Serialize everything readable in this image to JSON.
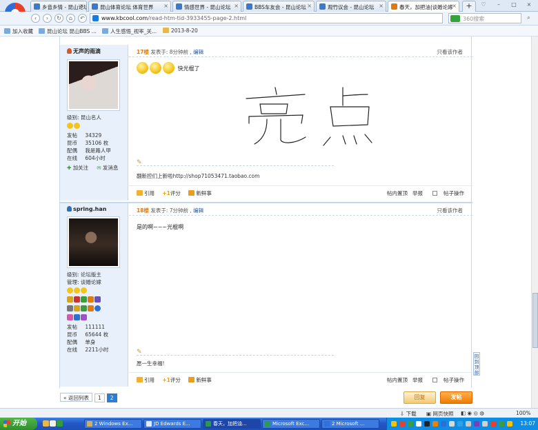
{
  "browser": {
    "tabs": [
      {
        "title": "乡音乡情 - 昆山论坛"
      },
      {
        "title": "昆山体育论坛 体育世界"
      },
      {
        "title": "情感世界 - 昆山论坛"
      },
      {
        "title": "BBS车友会 - 昆山论坛"
      },
      {
        "title": "观竹议会 - 昆山论坛"
      },
      {
        "title": "春天，加把油|谈婚论嫁"
      }
    ],
    "new_tab": "+",
    "url_domain": "www.kbcool.com",
    "url_path": "/read-htm-tid-3933455-page-2.html",
    "search_placeholder": "360搜索",
    "bookmarks": [
      {
        "label": "加入收藏"
      },
      {
        "label": "昆山论坛 昆山BBS ..."
      },
      {
        "label": "人生感悟_视率_关..."
      },
      {
        "label": "2013-8-20"
      }
    ]
  },
  "posts": [
    {
      "username": "无声的雨滴",
      "level_label": "级别:",
      "level": "昆山名人",
      "stats": [
        {
          "k": "发帖",
          "v": "34329"
        },
        {
          "k": "昆币",
          "v": "35106 枚"
        },
        {
          "k": "配偶",
          "v": "我是路人甲"
        },
        {
          "k": "在线",
          "v": "604小时"
        }
      ],
      "follow": "加关注",
      "message": "发消息",
      "floor": "17楼",
      "time": "发表于: 8分钟前 ,",
      "edit": "编辑",
      "only_author": "只看该作者",
      "body": "快光棍了",
      "handwriting": "亮 点",
      "signature": "翻新控们上新啦http://shop71053471.taobao.com"
    },
    {
      "username": "spring.han",
      "level_label": "级别:",
      "level": "论坛版主",
      "role_label": "管理:",
      "role": "谈婚论嫁",
      "stats": [
        {
          "k": "发帖",
          "v": "111111"
        },
        {
          "k": "昆币",
          "v": "65644 枚"
        },
        {
          "k": "配偶",
          "v": "单身"
        },
        {
          "k": "在线",
          "v": "2211小时"
        }
      ],
      "floor": "18楼",
      "time": "发表于: 7分钟前 ,",
      "edit": "编辑",
      "only_author": "只看该作者",
      "body": "是的啊~~~光棍啊",
      "signature": "愿一生幸福!"
    }
  ],
  "actions": {
    "quote": "引用",
    "rate": "评分",
    "share": "新鲜事",
    "pin": "帖内置顶",
    "report": "举报",
    "manage": "帖子操作"
  },
  "pager": {
    "back": "« 返回列表",
    "pages": [
      "1",
      "2"
    ],
    "current": "2"
  },
  "reply_button": "回复",
  "post_button": "发帖",
  "back_top": "回到顶部",
  "status": {
    "download": "下载",
    "web_accel": "网页快照",
    "zoom": "100%"
  },
  "taskbar": {
    "start": "开始",
    "tasks": [
      {
        "label": "2 Windows Ex..."
      },
      {
        "label": "JD Edwards E..."
      },
      {
        "label": "春天，加把油..."
      },
      {
        "label": "Microsoft Exc..."
      },
      {
        "label": "2 Microsoft ..."
      }
    ],
    "clock": "13:07"
  }
}
